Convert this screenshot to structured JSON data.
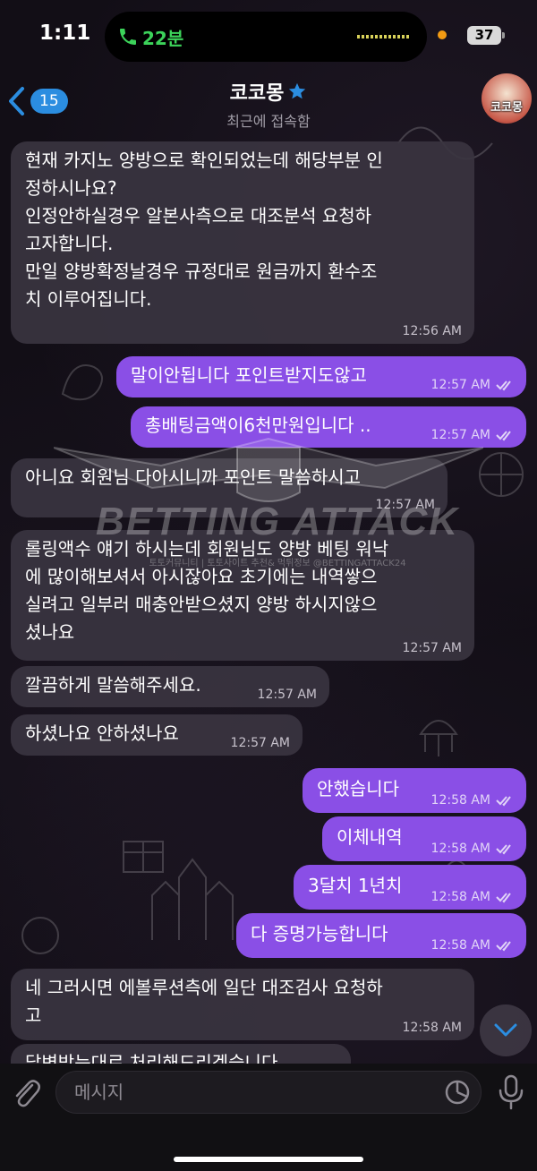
{
  "status_bar": {
    "time": "1:11",
    "call_duration": "22분",
    "battery": "37"
  },
  "header": {
    "back_badge": "15",
    "title": "코코몽",
    "subtitle": "최근에 접속함",
    "avatar_text": "코코몽"
  },
  "messages": [
    {
      "direction": "in",
      "text": "현재 카지노 양방으로 확인되었는데 해당부분 인\n정하시나요?\n인정안하실경우 알본사측으로 대조분석 요청하\n고자합니다.\n만일 양방확정날경우 규정대로 원금까지 환수조\n치 이루어집니다.",
      "time": "12:56 AM"
    },
    {
      "direction": "out",
      "text": "말이안됩니다 포인트받지도않고",
      "time": "12:57 AM"
    },
    {
      "direction": "out",
      "text": "총배팅금액이6천만원입니다 ..",
      "time": "12:57 AM"
    },
    {
      "direction": "in",
      "text": "아니요 회원님 다아시니까 포인트 말씀하시고",
      "time": "12:57 AM"
    },
    {
      "direction": "in",
      "text": "롤링액수 얘기 하시는데 회원님도 양방 베팅 워낙\n에 많이해보셔서 아시잖아요 초기에는 내역쌓으\n실려고 일부러 매충안받으셨지 양방 하시지않으\n셨나요",
      "time": "12:57 AM"
    },
    {
      "direction": "in",
      "text": "깔끔하게 말씀해주세요.",
      "time": "12:57 AM"
    },
    {
      "direction": "in",
      "text": "하셨나요 안하셨나요",
      "time": "12:57 AM"
    },
    {
      "direction": "out",
      "text": "안했습니다",
      "time": "12:58 AM"
    },
    {
      "direction": "out",
      "text": "이체내역",
      "time": "12:58 AM"
    },
    {
      "direction": "out",
      "text": "3달치 1년치",
      "time": "12:58 AM"
    },
    {
      "direction": "out",
      "text": "다 증명가능합니다",
      "time": "12:58 AM"
    },
    {
      "direction": "in",
      "text": "네 그러시면 에볼루션측에 일단 대조검사 요청하\n고",
      "time": "12:58 AM"
    },
    {
      "direction": "in",
      "text": "답변받는대로 처리해드리겠습니다",
      "time": ""
    }
  ],
  "watermark": {
    "title": "BETTING ATTACK",
    "subtitle": "토토커뮤니티 | 토토사이트 추천& 먹튀정보 @BETTINGATTACK24"
  },
  "input": {
    "placeholder": "메시지"
  },
  "colors": {
    "outgoing_bubble": "#8a4fe6",
    "incoming_bubble": "#3a3440",
    "badge": "#2b8de0",
    "call_green": "#3cd35a"
  }
}
